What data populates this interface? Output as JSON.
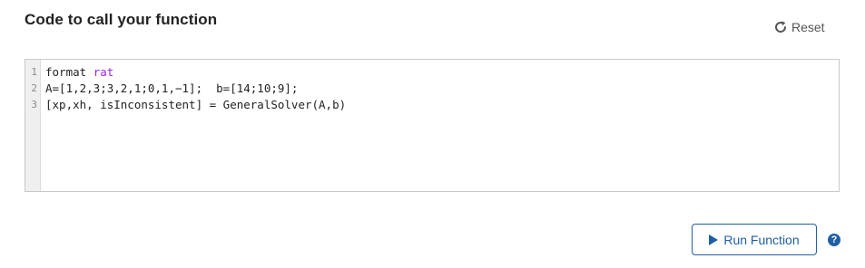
{
  "header": {
    "title": "Code to call your function",
    "reset_label": "Reset",
    "reset_icon": "refresh-icon"
  },
  "editor": {
    "line_numbers": [
      "1",
      "2",
      "3"
    ],
    "lines": {
      "line1_keyword": "format",
      "line1_arg": "rat",
      "line2": "A=[1,2,3;3,2,1;0,1,−1];  b=[14;10;9];",
      "line3": "[xp,xh, isInconsistent] = GeneralSolver(A,b)"
    }
  },
  "actions": {
    "run_label": "Run Function",
    "run_icon": "play-icon",
    "help_glyph": "?",
    "help_icon": "help-icon"
  },
  "colors": {
    "accent": "#1f5fa3",
    "keyword_purple": "#a020f0",
    "gutter_bg": "#efefef"
  }
}
